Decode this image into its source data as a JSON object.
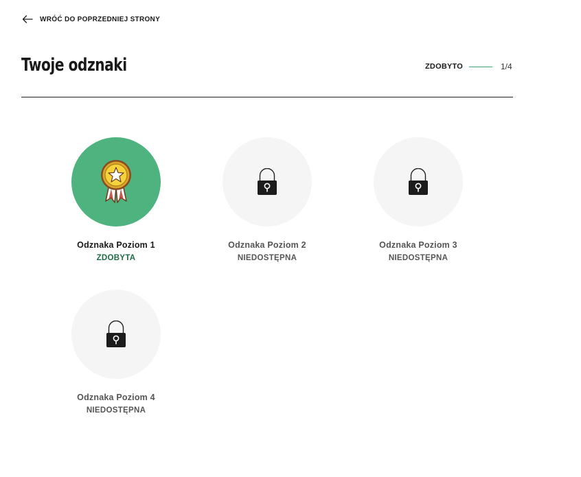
{
  "nav": {
    "back_label": "WRÓĆ DO POPRZEDNIEJ STRONY"
  },
  "page": {
    "title": "Twoje odznaki"
  },
  "progress": {
    "label": "ZDOBYTO",
    "count": "1/4",
    "earned": 1,
    "total": 4
  },
  "colors": {
    "accent": "#4eb37e",
    "locked_bg": "#f5f5f5",
    "status_earned": "#1f6b45"
  },
  "badges": [
    {
      "name": "Odznaka Poziom 1",
      "status": "ZDOBYTA",
      "state": "earned",
      "icon": "medal-icon"
    },
    {
      "name": "Odznaka Poziom 2",
      "status": "NIEDOSTĘPNA",
      "state": "locked",
      "icon": "lock-icon"
    },
    {
      "name": "Odznaka Poziom 3",
      "status": "NIEDOSTĘPNA",
      "state": "locked",
      "icon": "lock-icon"
    },
    {
      "name": "Odznaka Poziom 4",
      "status": "NIEDOSTĘPNA",
      "state": "locked",
      "icon": "lock-icon"
    }
  ]
}
